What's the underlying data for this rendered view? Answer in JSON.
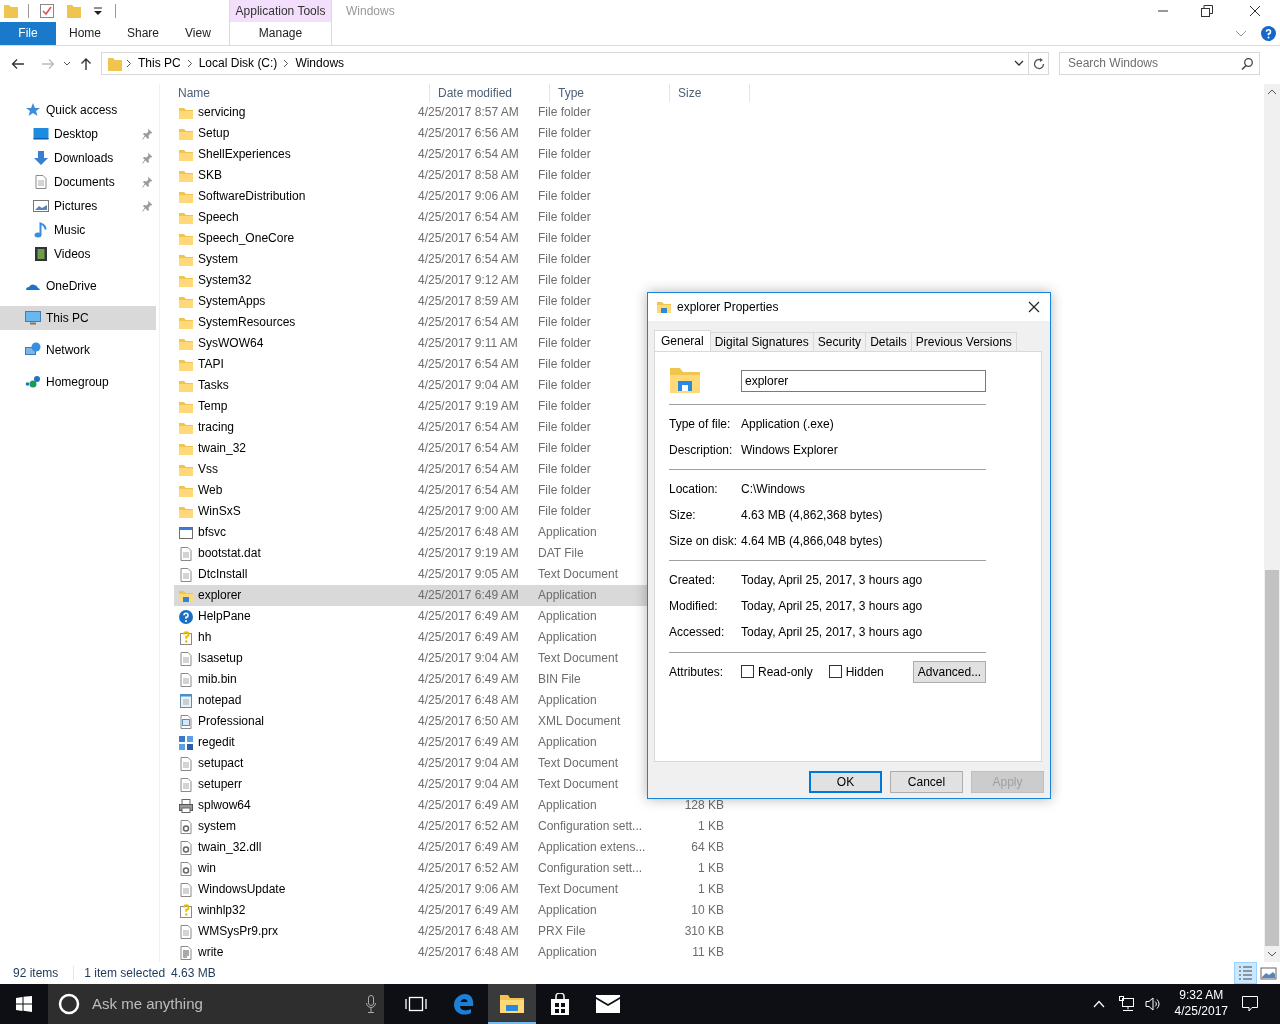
{
  "window": {
    "title": "Windows"
  },
  "context_tab_group": {
    "label": "Application Tools"
  },
  "ribbon_tabs": [
    {
      "label": "File",
      "kind": "file"
    },
    {
      "label": "Home",
      "kind": "normal"
    },
    {
      "label": "Share",
      "kind": "normal"
    },
    {
      "label": "View",
      "kind": "normal"
    },
    {
      "label": "Manage",
      "kind": "context"
    }
  ],
  "address": {
    "crumbs": [
      "This PC",
      "Local Disk (C:)",
      "Windows"
    ]
  },
  "search": {
    "placeholder": "Search Windows"
  },
  "nav": [
    {
      "label": "Quick access",
      "kind": "star",
      "selected": false,
      "children": [
        {
          "label": "Desktop",
          "kind": "desktop",
          "pinned": true,
          "selected": false
        },
        {
          "label": "Downloads",
          "kind": "downloads",
          "pinned": true,
          "selected": false
        },
        {
          "label": "Documents",
          "kind": "documents",
          "pinned": true,
          "selected": false
        },
        {
          "label": "Pictures",
          "kind": "pictures",
          "pinned": true,
          "selected": false
        },
        {
          "label": "Music",
          "kind": "music",
          "pinned": false,
          "selected": false
        },
        {
          "label": "Videos",
          "kind": "videos",
          "pinned": false,
          "selected": false
        }
      ]
    },
    {
      "label": "OneDrive",
      "kind": "cloud",
      "selected": false
    },
    {
      "label": "This PC",
      "kind": "computer",
      "selected": true
    },
    {
      "label": "Network",
      "kind": "network",
      "selected": false
    },
    {
      "label": "Homegroup",
      "kind": "homegroup",
      "selected": false
    }
  ],
  "columns": [
    "Name",
    "Date modified",
    "Type",
    "Size"
  ],
  "files": [
    {
      "name": "servicing",
      "date": "4/25/2017 8:57 AM",
      "type": "File folder",
      "kind": "folder",
      "selected": false
    },
    {
      "name": "Setup",
      "date": "4/25/2017 6:56 AM",
      "type": "File folder",
      "kind": "folder",
      "selected": false
    },
    {
      "name": "ShellExperiences",
      "date": "4/25/2017 6:54 AM",
      "type": "File folder",
      "kind": "folder",
      "selected": false
    },
    {
      "name": "SKB",
      "date": "4/25/2017 8:58 AM",
      "type": "File folder",
      "kind": "folder",
      "selected": false
    },
    {
      "name": "SoftwareDistribution",
      "date": "4/25/2017 9:06 AM",
      "type": "File folder",
      "kind": "folder",
      "selected": false
    },
    {
      "name": "Speech",
      "date": "4/25/2017 6:54 AM",
      "type": "File folder",
      "kind": "folder",
      "selected": false
    },
    {
      "name": "Speech_OneCore",
      "date": "4/25/2017 6:54 AM",
      "type": "File folder",
      "kind": "folder",
      "selected": false
    },
    {
      "name": "System",
      "date": "4/25/2017 6:54 AM",
      "type": "File folder",
      "kind": "folder",
      "selected": false
    },
    {
      "name": "System32",
      "date": "4/25/2017 9:12 AM",
      "type": "File folder",
      "kind": "folder",
      "selected": false
    },
    {
      "name": "SystemApps",
      "date": "4/25/2017 8:59 AM",
      "type": "File folder",
      "kind": "folder",
      "selected": false
    },
    {
      "name": "SystemResources",
      "date": "4/25/2017 6:54 AM",
      "type": "File folder",
      "kind": "folder",
      "selected": false
    },
    {
      "name": "SysWOW64",
      "date": "4/25/2017 9:11 AM",
      "type": "File folder",
      "kind": "folder",
      "selected": false
    },
    {
      "name": "TAPI",
      "date": "4/25/2017 6:54 AM",
      "type": "File folder",
      "kind": "folder",
      "selected": false
    },
    {
      "name": "Tasks",
      "date": "4/25/2017 9:04 AM",
      "type": "File folder",
      "kind": "folder",
      "selected": false
    },
    {
      "name": "Temp",
      "date": "4/25/2017 9:19 AM",
      "type": "File folder",
      "kind": "folder",
      "selected": false
    },
    {
      "name": "tracing",
      "date": "4/25/2017 6:54 AM",
      "type": "File folder",
      "kind": "folder",
      "selected": false
    },
    {
      "name": "twain_32",
      "date": "4/25/2017 6:54 AM",
      "type": "File folder",
      "kind": "folder",
      "selected": false
    },
    {
      "name": "Vss",
      "date": "4/25/2017 6:54 AM",
      "type": "File folder",
      "kind": "folder",
      "selected": false
    },
    {
      "name": "Web",
      "date": "4/25/2017 6:54 AM",
      "type": "File folder",
      "kind": "folder",
      "selected": false
    },
    {
      "name": "WinSxS",
      "date": "4/25/2017 9:00 AM",
      "type": "File folder",
      "kind": "folder",
      "selected": false
    },
    {
      "name": "bfsvc",
      "date": "4/25/2017 6:48 AM",
      "type": "Application",
      "kind": "application",
      "selected": false
    },
    {
      "name": "bootstat.dat",
      "date": "4/25/2017 9:19 AM",
      "type": "DAT File",
      "kind": "document",
      "selected": false
    },
    {
      "name": "DtcInstall",
      "date": "4/25/2017 9:05 AM",
      "type": "Text Document",
      "kind": "document",
      "selected": false
    },
    {
      "name": "explorer",
      "date": "4/25/2017 6:49 AM",
      "type": "Application",
      "kind": "explorer",
      "selected": true
    },
    {
      "name": "HelpPane",
      "date": "4/25/2017 6:49 AM",
      "type": "Application",
      "kind": "help",
      "selected": false
    },
    {
      "name": "hh",
      "date": "4/25/2017 6:49 AM",
      "type": "Application",
      "kind": "question",
      "selected": false
    },
    {
      "name": "lsasetup",
      "date": "4/25/2017 9:04 AM",
      "type": "Text Document",
      "kind": "document",
      "selected": false
    },
    {
      "name": "mib.bin",
      "date": "4/25/2017 6:49 AM",
      "type": "BIN File",
      "kind": "document",
      "selected": false
    },
    {
      "name": "notepad",
      "date": "4/25/2017 6:48 AM",
      "type": "Application",
      "kind": "notepad",
      "selected": false
    },
    {
      "name": "Professional",
      "date": "4/25/2017 6:50 AM",
      "type": "XML Document",
      "kind": "xml",
      "selected": false
    },
    {
      "name": "regedit",
      "date": "4/25/2017 6:49 AM",
      "type": "Application",
      "kind": "registry",
      "selected": false
    },
    {
      "name": "setupact",
      "date": "4/25/2017 9:04 AM",
      "type": "Text Document",
      "kind": "document",
      "selected": false
    },
    {
      "name": "setuperr",
      "date": "4/25/2017 9:04 AM",
      "type": "Text Document",
      "kind": "document",
      "selected": false
    },
    {
      "name": "splwow64",
      "date": "4/25/2017 6:49 AM",
      "type": "Application",
      "size": "128 KB",
      "kind": "printer",
      "selected": false
    },
    {
      "name": "system",
      "date": "4/25/2017 6:52 AM",
      "type": "Configuration sett...",
      "size": "1 KB",
      "kind": "settings",
      "selected": false
    },
    {
      "name": "twain_32.dll",
      "date": "4/25/2017 6:49 AM",
      "type": "Application extens...",
      "size": "64 KB",
      "kind": "library",
      "selected": false
    },
    {
      "name": "win",
      "date": "4/25/2017 6:52 AM",
      "type": "Configuration sett...",
      "size": "1 KB",
      "kind": "settings",
      "selected": false
    },
    {
      "name": "WindowsUpdate",
      "date": "4/25/2017 9:06 AM",
      "type": "Text Document",
      "size": "1 KB",
      "kind": "document",
      "selected": false
    },
    {
      "name": "winhlp32",
      "date": "4/25/2017 6:49 AM",
      "type": "Application",
      "size": "10 KB",
      "kind": "question",
      "selected": false
    },
    {
      "name": "WMSysPr9.prx",
      "date": "4/25/2017 6:48 AM",
      "type": "PRX File",
      "size": "310 KB",
      "kind": "document",
      "selected": false
    },
    {
      "name": "write",
      "date": "4/25/2017 6:48 AM",
      "type": "Application",
      "size": "11 KB",
      "kind": "write",
      "selected": false
    }
  ],
  "status_bar": {
    "item_count": "92 items",
    "selection": "1 item selected",
    "selection_size": "4.63 MB"
  },
  "view_buttons": [
    {
      "kind": "details",
      "selected": true
    },
    {
      "kind": "large_icons",
      "selected": false
    }
  ],
  "dialog": {
    "title": "explorer Properties",
    "tabs": [
      {
        "label": "General",
        "selected": true
      },
      {
        "label": "Digital Signatures",
        "selected": false
      },
      {
        "label": "Security",
        "selected": false
      },
      {
        "label": "Details",
        "selected": false
      },
      {
        "label": "Previous Versions",
        "selected": false
      }
    ],
    "name_value": "explorer",
    "groups": [
      [
        {
          "label": "Type of file:",
          "value": "Application (.exe)"
        },
        {
          "label": "Description:",
          "value": "Windows Explorer"
        }
      ],
      [
        {
          "label": "Location:",
          "value": "C:\\Windows"
        },
        {
          "label": "Size:",
          "value": "4.63 MB (4,862,368 bytes)"
        },
        {
          "label": "Size on disk:",
          "value": "4.64 MB (4,866,048 bytes)"
        }
      ],
      [
        {
          "label": "Created:",
          "value": "Today, April 25, 2017, 3 hours ago"
        },
        {
          "label": "Modified:",
          "value": "Today, April 25, 2017, 3 hours ago"
        },
        {
          "label": "Accessed:",
          "value": "Today, April 25, 2017, 3 hours ago"
        }
      ]
    ],
    "attributes_label": "Attributes:",
    "attributes": [
      {
        "label": "Read-only",
        "checked": false
      },
      {
        "label": "Hidden",
        "checked": false
      }
    ],
    "advanced_button": "Advanced...",
    "buttons": [
      {
        "label": "OK",
        "kind": "default",
        "disabled": false
      },
      {
        "label": "Cancel",
        "kind": "normal",
        "disabled": false
      },
      {
        "label": "Apply",
        "kind": "normal",
        "disabled": true
      }
    ]
  },
  "taskbar": {
    "search_placeholder": "Ask me anything",
    "apps": [
      {
        "kind": "task_view",
        "active": false
      },
      {
        "kind": "edge",
        "active": false
      },
      {
        "kind": "explorer",
        "active": true
      },
      {
        "kind": "store",
        "active": false
      },
      {
        "kind": "mail",
        "active": false
      }
    ],
    "time": "9:32 AM",
    "date": "4/25/2017"
  }
}
